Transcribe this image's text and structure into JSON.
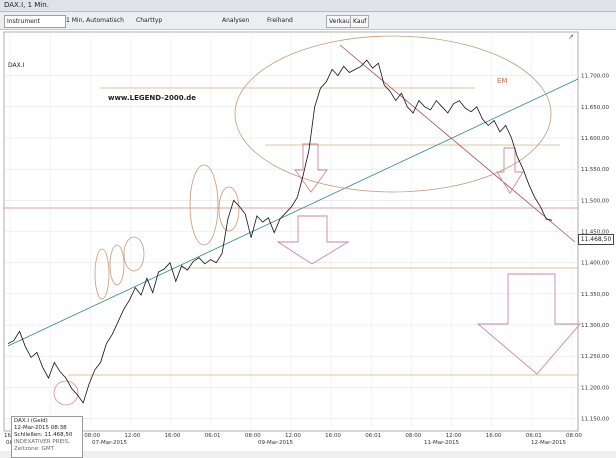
{
  "window": {
    "title": "DAX.I, 1 Min."
  },
  "toolbar": {
    "instrument_value": "Instrument",
    "interval_label": "1 Min, Automatisch",
    "charttyp_label": "Charttyp",
    "analysen_label": "Analysen",
    "freehand_label": "Freihand",
    "verkauf_label": "Verkauf",
    "kauf_label": "Kauf"
  },
  "chart_header": {
    "instrument": "DAX.I"
  },
  "watermark": "www.LEGEND-2000.de",
  "annotation_label": "EM",
  "price_label": "11.468,50",
  "infobox": {
    "line1": "DAX.I (Geld)",
    "line2": "12-Mar-2015 08:38",
    "line3_label": "Schließen:",
    "line3_value": "11.468,50",
    "line4": "INDEXATIVER PREIS, Zeitzone: GMT"
  },
  "y_axis_labels": [
    "11.700,00",
    "11.650,00",
    "11.600,00",
    "11.550,00",
    "11.500,00",
    "11.450,00",
    "11.400,00",
    "11.350,00",
    "11.300,00",
    "11.250,00",
    "11.200,00",
    "11.150,00"
  ],
  "x_time_labels": [
    "16:00",
    "06:01",
    "08:00",
    "12:00",
    "16:00",
    "06:01",
    "08:00",
    "12:00",
    "16:00",
    "06:01",
    "08:00",
    "12:00",
    "16:00",
    "06:01",
    "08:00"
  ],
  "x_date_labels": [
    "06",
    "07-Mar-2015",
    "09-Mar-2015",
    "11-Mar-2015",
    "12-Mar-2015"
  ],
  "chart_data": {
    "type": "line",
    "series": [
      {
        "values": [
          11270,
          11275,
          11290,
          11265,
          11248,
          11256,
          11232,
          11215,
          11240,
          11225,
          11215,
          11198,
          11188,
          11175,
          11205,
          11228,
          11240,
          11270,
          11285,
          11305,
          11325,
          11340,
          11360,
          11348,
          11375,
          11352,
          11385,
          11390,
          11400,
          11370,
          11395,
          11388,
          11402,
          11408,
          11398,
          11405,
          11400,
          11415,
          11470,
          11500,
          11490,
          11478,
          11440,
          11475,
          11465,
          11472,
          11448,
          11470,
          11480,
          11490,
          11505,
          11540,
          11580,
          11650,
          11680,
          11690,
          11710,
          11700,
          11715,
          11705,
          11710,
          11715,
          11725,
          11712,
          11720,
          11685,
          11675,
          11660,
          11672,
          11650,
          11640,
          11660,
          11650,
          11645,
          11660,
          11650,
          11640,
          11655,
          11660,
          11648,
          11642,
          11650,
          11630,
          11620,
          11628,
          11610,
          11620,
          11600,
          11570,
          11550,
          11525,
          11505,
          11490,
          11470,
          11468
        ]
      }
    ],
    "ylim": [
      11130,
      11770
    ]
  }
}
